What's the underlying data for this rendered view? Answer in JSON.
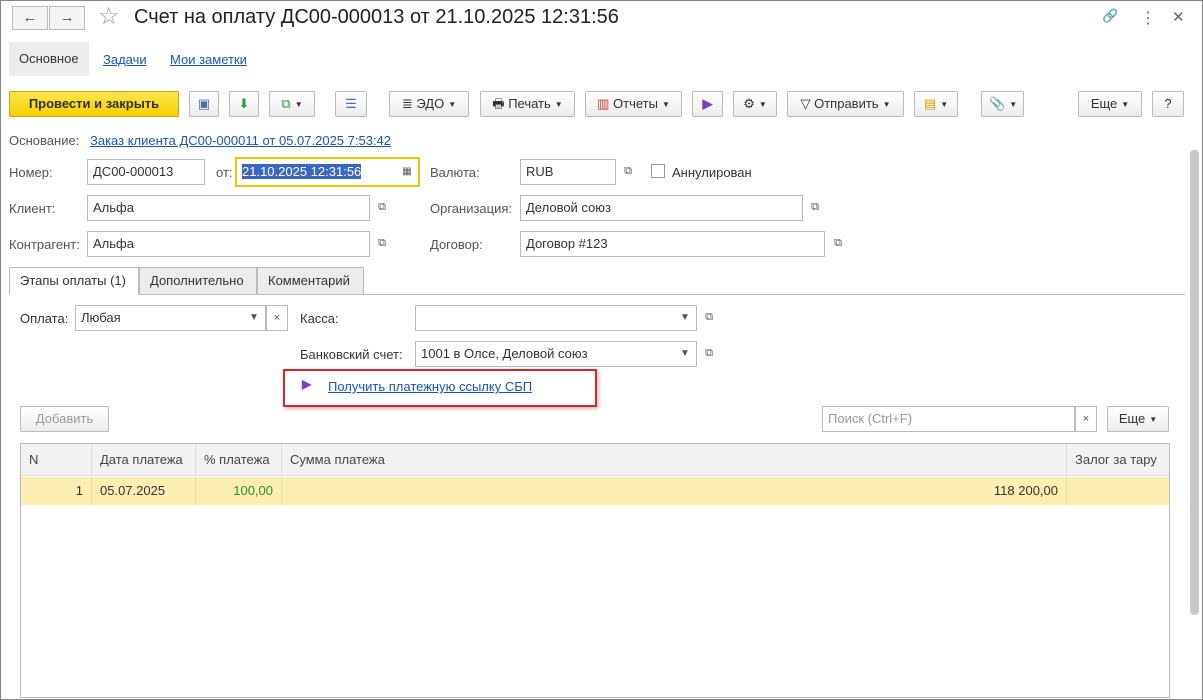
{
  "window": {
    "title": "Счет на оплату ДС00-000013 от 21.10.2025 12:31:56",
    "back": "←",
    "forward": "→",
    "star": "☆",
    "link_icon": "🔗",
    "menu_icon": "⋮",
    "close_icon": "✕"
  },
  "nav_tabs": [
    {
      "label": "Основное"
    },
    {
      "label": "Задачи"
    },
    {
      "label": "Мои заметки"
    }
  ],
  "toolbar": {
    "post_close": "Провести и закрыть",
    "edo": "ЭДО",
    "print": "Печать",
    "reports": "Отчеты",
    "send": "Отправить",
    "more": "Еще",
    "help": "?"
  },
  "basis": {
    "label": "Основание:",
    "value": "Заказ клиента ДС00-000011 от 05.07.2025 7:53:42"
  },
  "form": {
    "number_label": "Номер:",
    "number": "ДС00-000013",
    "from_label": "от:",
    "date": "21.10.2025 12:31:56",
    "currency_label": "Валюта:",
    "currency": "RUB",
    "cancelled_label": "Аннулирован",
    "client_label": "Клиент:",
    "client": "Альфа",
    "org_label": "Организация:",
    "org": "Деловой союз",
    "contractor_label": "Контрагент:",
    "contractor": "Альфа",
    "contract_label": "Договор:",
    "contract": "Договор #123"
  },
  "tabs": [
    {
      "label": "Этапы оплаты (1)"
    },
    {
      "label": "Дополнительно"
    },
    {
      "label": "Комментарий"
    }
  ],
  "payment": {
    "pay_label": "Оплата:",
    "pay": "Любая",
    "cash_label": "Касса:",
    "cash": "",
    "bank_label": "Банковский счет:",
    "bank": "1001 в Олсе, Деловой союз",
    "sbp_link": "Получить платежную ссылку СБП"
  },
  "table_toolbar": {
    "add": "Добавить",
    "search_placeholder": "Поиск (Ctrl+F)",
    "more": "Еще"
  },
  "table": {
    "columns": [
      "N",
      "Дата платежа",
      "% платежа",
      "Сумма платежа",
      "Залог за тару"
    ],
    "rows": [
      {
        "n": "1",
        "date": "05.07.2025",
        "percent": "100,00",
        "sum": "118 200,00",
        "deposit": ""
      }
    ]
  },
  "colors": {
    "accent": "#f5cf00",
    "link": "#1a55b5",
    "highlight": "#fbeeb0",
    "red_box": "#d9262c"
  }
}
